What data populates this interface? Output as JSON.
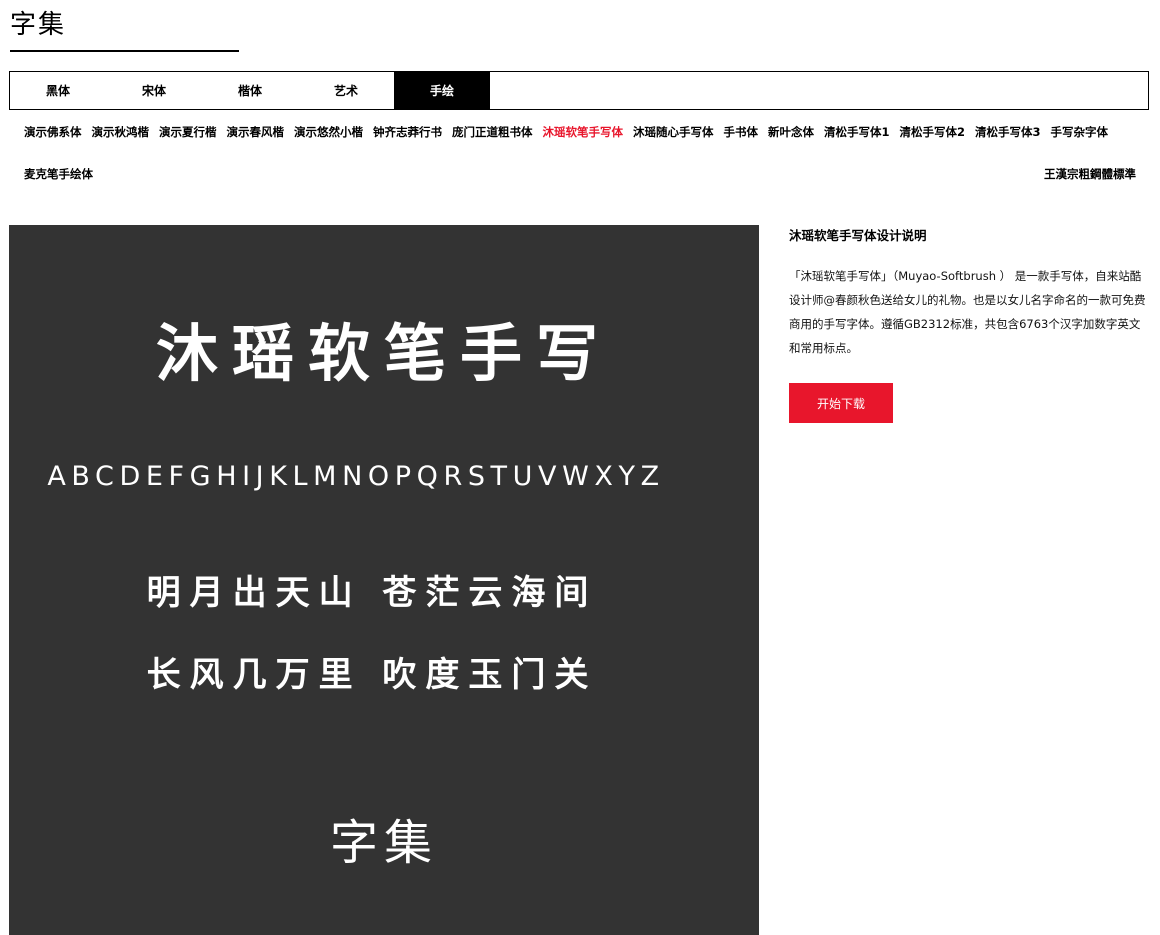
{
  "site": {
    "title": "字集"
  },
  "tabs": [
    {
      "label": "黑体",
      "active": false
    },
    {
      "label": "宋体",
      "active": false
    },
    {
      "label": "楷体",
      "active": false
    },
    {
      "label": "艺术",
      "active": false
    },
    {
      "label": "手绘",
      "active": true
    }
  ],
  "fonts": {
    "row1": [
      "演示佛系体",
      "演示秋鸿楷",
      "演示夏行楷",
      "演示春风楷",
      "演示悠然小楷",
      "钟齐志莽行书",
      "庞门正道粗书体",
      "沐瑶软笔手写体",
      "沐瑶随心手写体",
      "手书体",
      "新叶念体",
      "清松手写体1",
      "清松手写体2",
      "清松手写体3",
      "手写杂字体"
    ],
    "row2": [
      "麦克笔手绘体",
      "王漢宗粗鋼體標準"
    ],
    "selected": "沐瑶软笔手写体",
    "selected_color": "#e8162c"
  },
  "preview": {
    "background": "#333333",
    "title_text": "沐瑶软笔手写",
    "alphabet": "ABCDEFGHIJKLMNOPQRSTUVWXYZ",
    "poem_line1": "明月出天山 苍茫云海间",
    "poem_line2": "长风几万里 吹度玉门关",
    "brand": "字集"
  },
  "info": {
    "title": "沐瑶软笔手写体设计说明",
    "description": "「沐瑶软笔手写体」（Muyao-Softbrush ） 是一款手写体，自来站酷设计师@春颜秋色送给女儿的礼物。也是以女儿名字命名的一款可免费商用的手写字体。遵循GB2312标准，共包含6763个汉字加数字英文和常用标点。",
    "download_label": "开始下载",
    "download_color": "#e8162c"
  }
}
